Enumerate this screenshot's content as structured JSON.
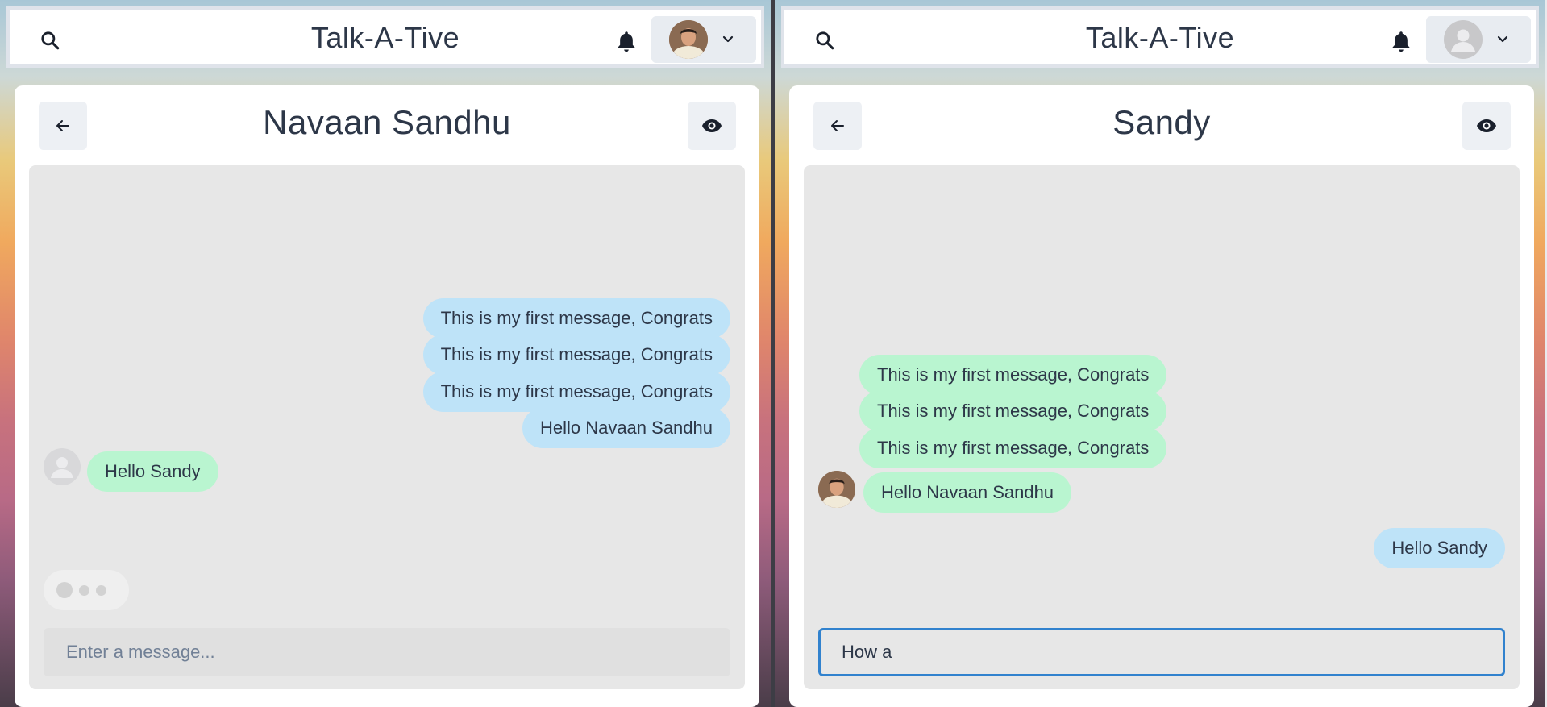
{
  "app": {
    "title": "Talk-A-Tive"
  },
  "colors": {
    "sent_bubble": "#bee3f8",
    "received_bubble": "#b9f5d0",
    "messages_bg": "#e7e7e7",
    "input_focus_border": "#3182ce",
    "title_text": "#2d3748"
  },
  "icons": {
    "search": "search-icon",
    "notifications": "bell-icon",
    "profile_menu": "chevron-down-icon",
    "back": "arrow-left-icon",
    "view_profile": "eye-icon"
  },
  "left": {
    "chat_name": "Navaan Sandhu",
    "messages": [
      {
        "text": "This is my first message, Congrats",
        "from": "me"
      },
      {
        "text": "This is my first message, Congrats",
        "from": "me"
      },
      {
        "text": "This is my first message, Congrats",
        "from": "me"
      },
      {
        "text": "Hello Navaan Sandhu",
        "from": "me"
      },
      {
        "text": "Hello Sandy",
        "from": "them"
      }
    ],
    "typing_indicator": true,
    "input": {
      "placeholder": "Enter a message...",
      "value": ""
    }
  },
  "right": {
    "chat_name": "Sandy",
    "messages": [
      {
        "text": "This is my first message, Congrats",
        "from": "them"
      },
      {
        "text": "This is my first message, Congrats",
        "from": "them"
      },
      {
        "text": "This is my first message, Congrats",
        "from": "them"
      },
      {
        "text": "Hello Navaan Sandhu",
        "from": "them"
      },
      {
        "text": "Hello Sandy",
        "from": "me"
      }
    ],
    "input": {
      "placeholder": "Enter a message...",
      "value": "How a"
    }
  }
}
